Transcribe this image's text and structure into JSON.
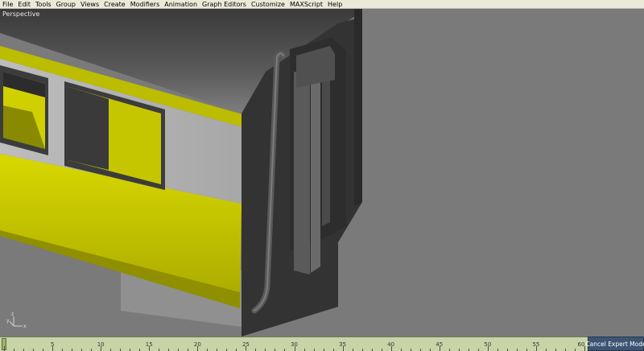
{
  "menu": {
    "items": [
      "File",
      "Edit",
      "Tools",
      "Group",
      "Views",
      "Create",
      "Modifiers",
      "Animation",
      "Graph Editors",
      "Customize",
      "MAXScript",
      "Help"
    ]
  },
  "viewport": {
    "label": "Perspective",
    "axis": {
      "x": "x",
      "y": "y",
      "z": "z"
    }
  },
  "timeline": {
    "current_frame": 0,
    "total_frames": 60,
    "labels": [
      "5",
      "10",
      "15",
      "20",
      "25",
      "30",
      "35",
      "40",
      "45",
      "50",
      "55",
      "60"
    ]
  },
  "expert_mode_button": "Cancel Expert Mode",
  "colors": {
    "menubar": "#ece9d8",
    "viewport": "#7a7a7a",
    "yellow_stripe": "#c8c800",
    "body_grey": "#b4b4b4",
    "dark_end": "#333333",
    "timeline": "#c8d4a8",
    "expert_button": "#3b5573"
  }
}
